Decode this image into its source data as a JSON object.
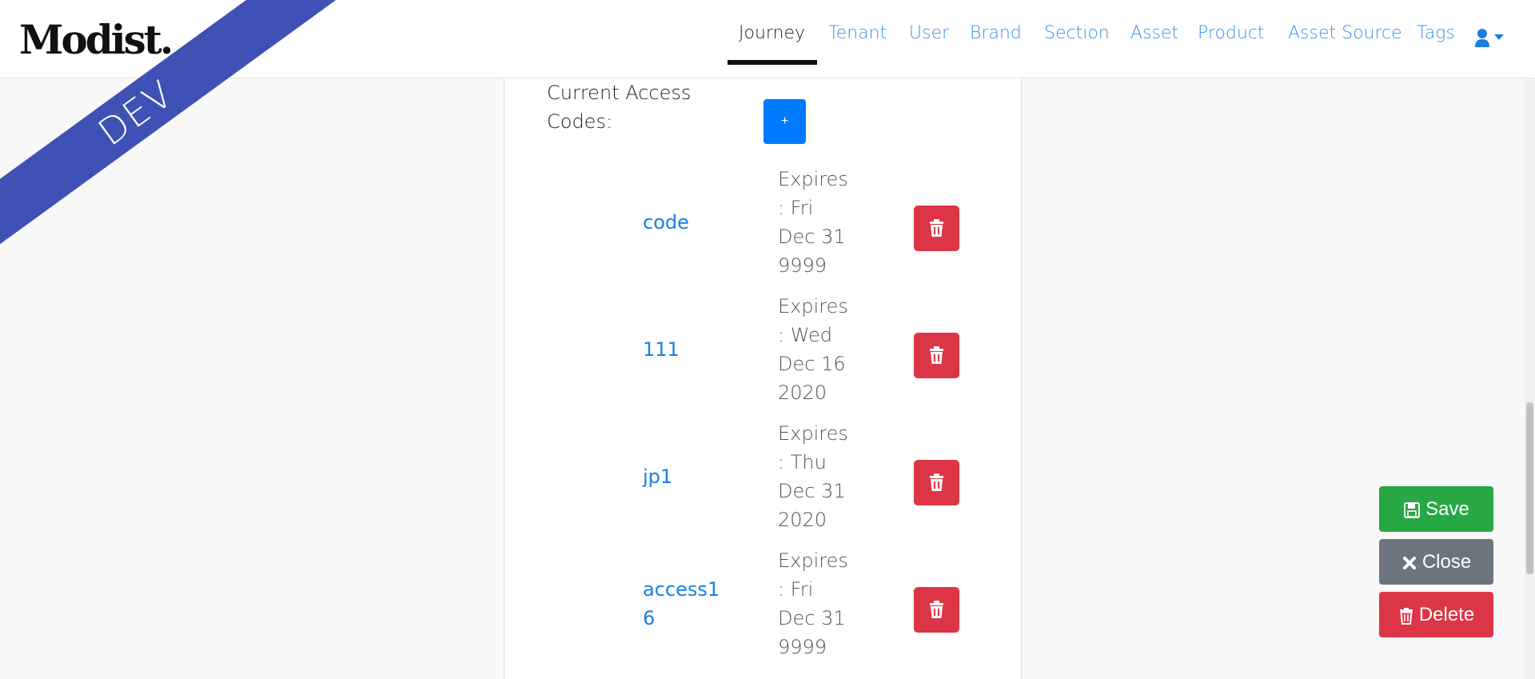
{
  "brand": {
    "logo_text": "Modist.",
    "env_badge": "DEV"
  },
  "nav": {
    "items": [
      {
        "label": "Journey",
        "active": true
      },
      {
        "label": "Tenant"
      },
      {
        "label": "User"
      },
      {
        "label": "Brand"
      },
      {
        "label": "Section"
      },
      {
        "label": "Asset"
      },
      {
        "label": "Product"
      },
      {
        "label": "Asset Source"
      },
      {
        "label": "Tags"
      }
    ],
    "user_icon": "user-icon",
    "dropdown_icon": "caret-down-icon"
  },
  "access_codes": {
    "label": "Current Access Codes:",
    "add_label": "+",
    "items": [
      {
        "code": "code",
        "expires": "Expires : Fri Dec 31 9999"
      },
      {
        "code": "111",
        "expires": "Expires : Wed Dec 16 2020"
      },
      {
        "code": "jp1",
        "expires": "Expires : Thu Dec 31 2020"
      },
      {
        "code": "access16",
        "expires": "Expires : Fri Dec 31 9999"
      }
    ],
    "delete_icon": "trash-icon"
  },
  "actions": {
    "save_label": "Save",
    "close_label": "Close",
    "delete_label": "Delete"
  },
  "colors": {
    "primary": "#007bff",
    "danger": "#dc3545",
    "success": "#28a745",
    "secondary": "#6c757d",
    "ribbon": "#3f51b5"
  }
}
